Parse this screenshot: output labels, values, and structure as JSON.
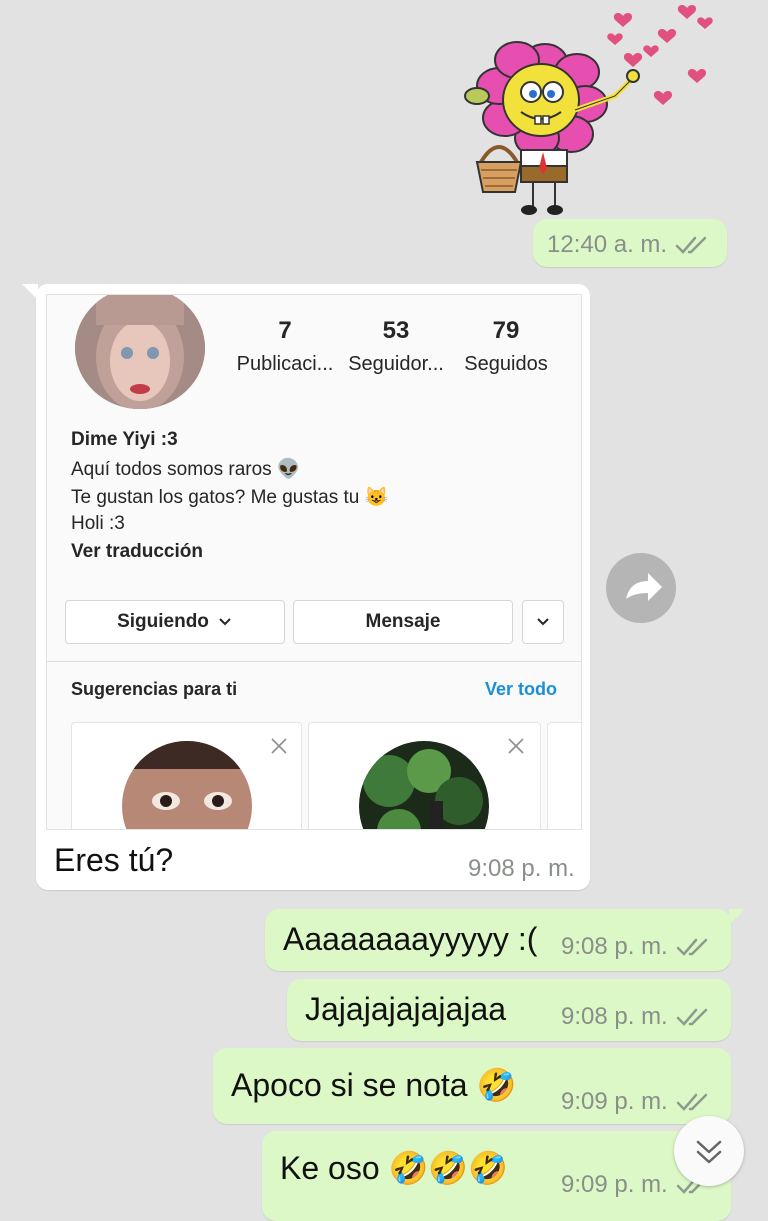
{
  "messages": [
    {
      "id": "m1",
      "direction": "out",
      "type": "sticker",
      "time": "12:40 a. m."
    },
    {
      "id": "m2",
      "direction": "in",
      "type": "instagram-profile",
      "text": "Eres tú?",
      "time": "9:08 p. m."
    },
    {
      "id": "m3",
      "direction": "out",
      "text": "Aaaaaaaayyyyy :(",
      "time": "9:08 p. m."
    },
    {
      "id": "m4",
      "direction": "out",
      "text": "Jajajajajajajaa",
      "time": "9:08 p. m."
    },
    {
      "id": "m5",
      "direction": "out",
      "text": "Apoco si se nota",
      "emoji": "🤣",
      "time": "9:09 p. m."
    },
    {
      "id": "m6",
      "direction": "out",
      "text": "Ke oso",
      "emoji": "🤣🤣🤣",
      "time": "9:09 p. m."
    }
  ],
  "ig_profile": {
    "stats": [
      {
        "value": "7",
        "label": "Publicaci..."
      },
      {
        "value": "53",
        "label": "Seguidor..."
      },
      {
        "value": "79",
        "label": "Seguidos"
      }
    ],
    "name": "Dime Yiyi :3",
    "bio_lines": [
      "Aquí todos somos raros 👽",
      "Te gustan los gatos? Me gustas tu 😺",
      "Holi :3"
    ],
    "translate_link": "Ver traducción",
    "following_button": "Siguiendo",
    "message_button": "Mensaje",
    "suggestions_title": "Sugerencias para ti",
    "see_all": "Ver todo"
  },
  "colors": {
    "background": "#e2e2e2",
    "outgoing_bubble": "#dcf8c6",
    "incoming_bubble": "#ffffff",
    "link_blue": "#1a8fd8",
    "ticks": "#8e9a8e"
  },
  "icons": [
    "forward-icon",
    "scroll-down-icon",
    "double-check-icon",
    "chevron-down-icon",
    "close-icon"
  ]
}
